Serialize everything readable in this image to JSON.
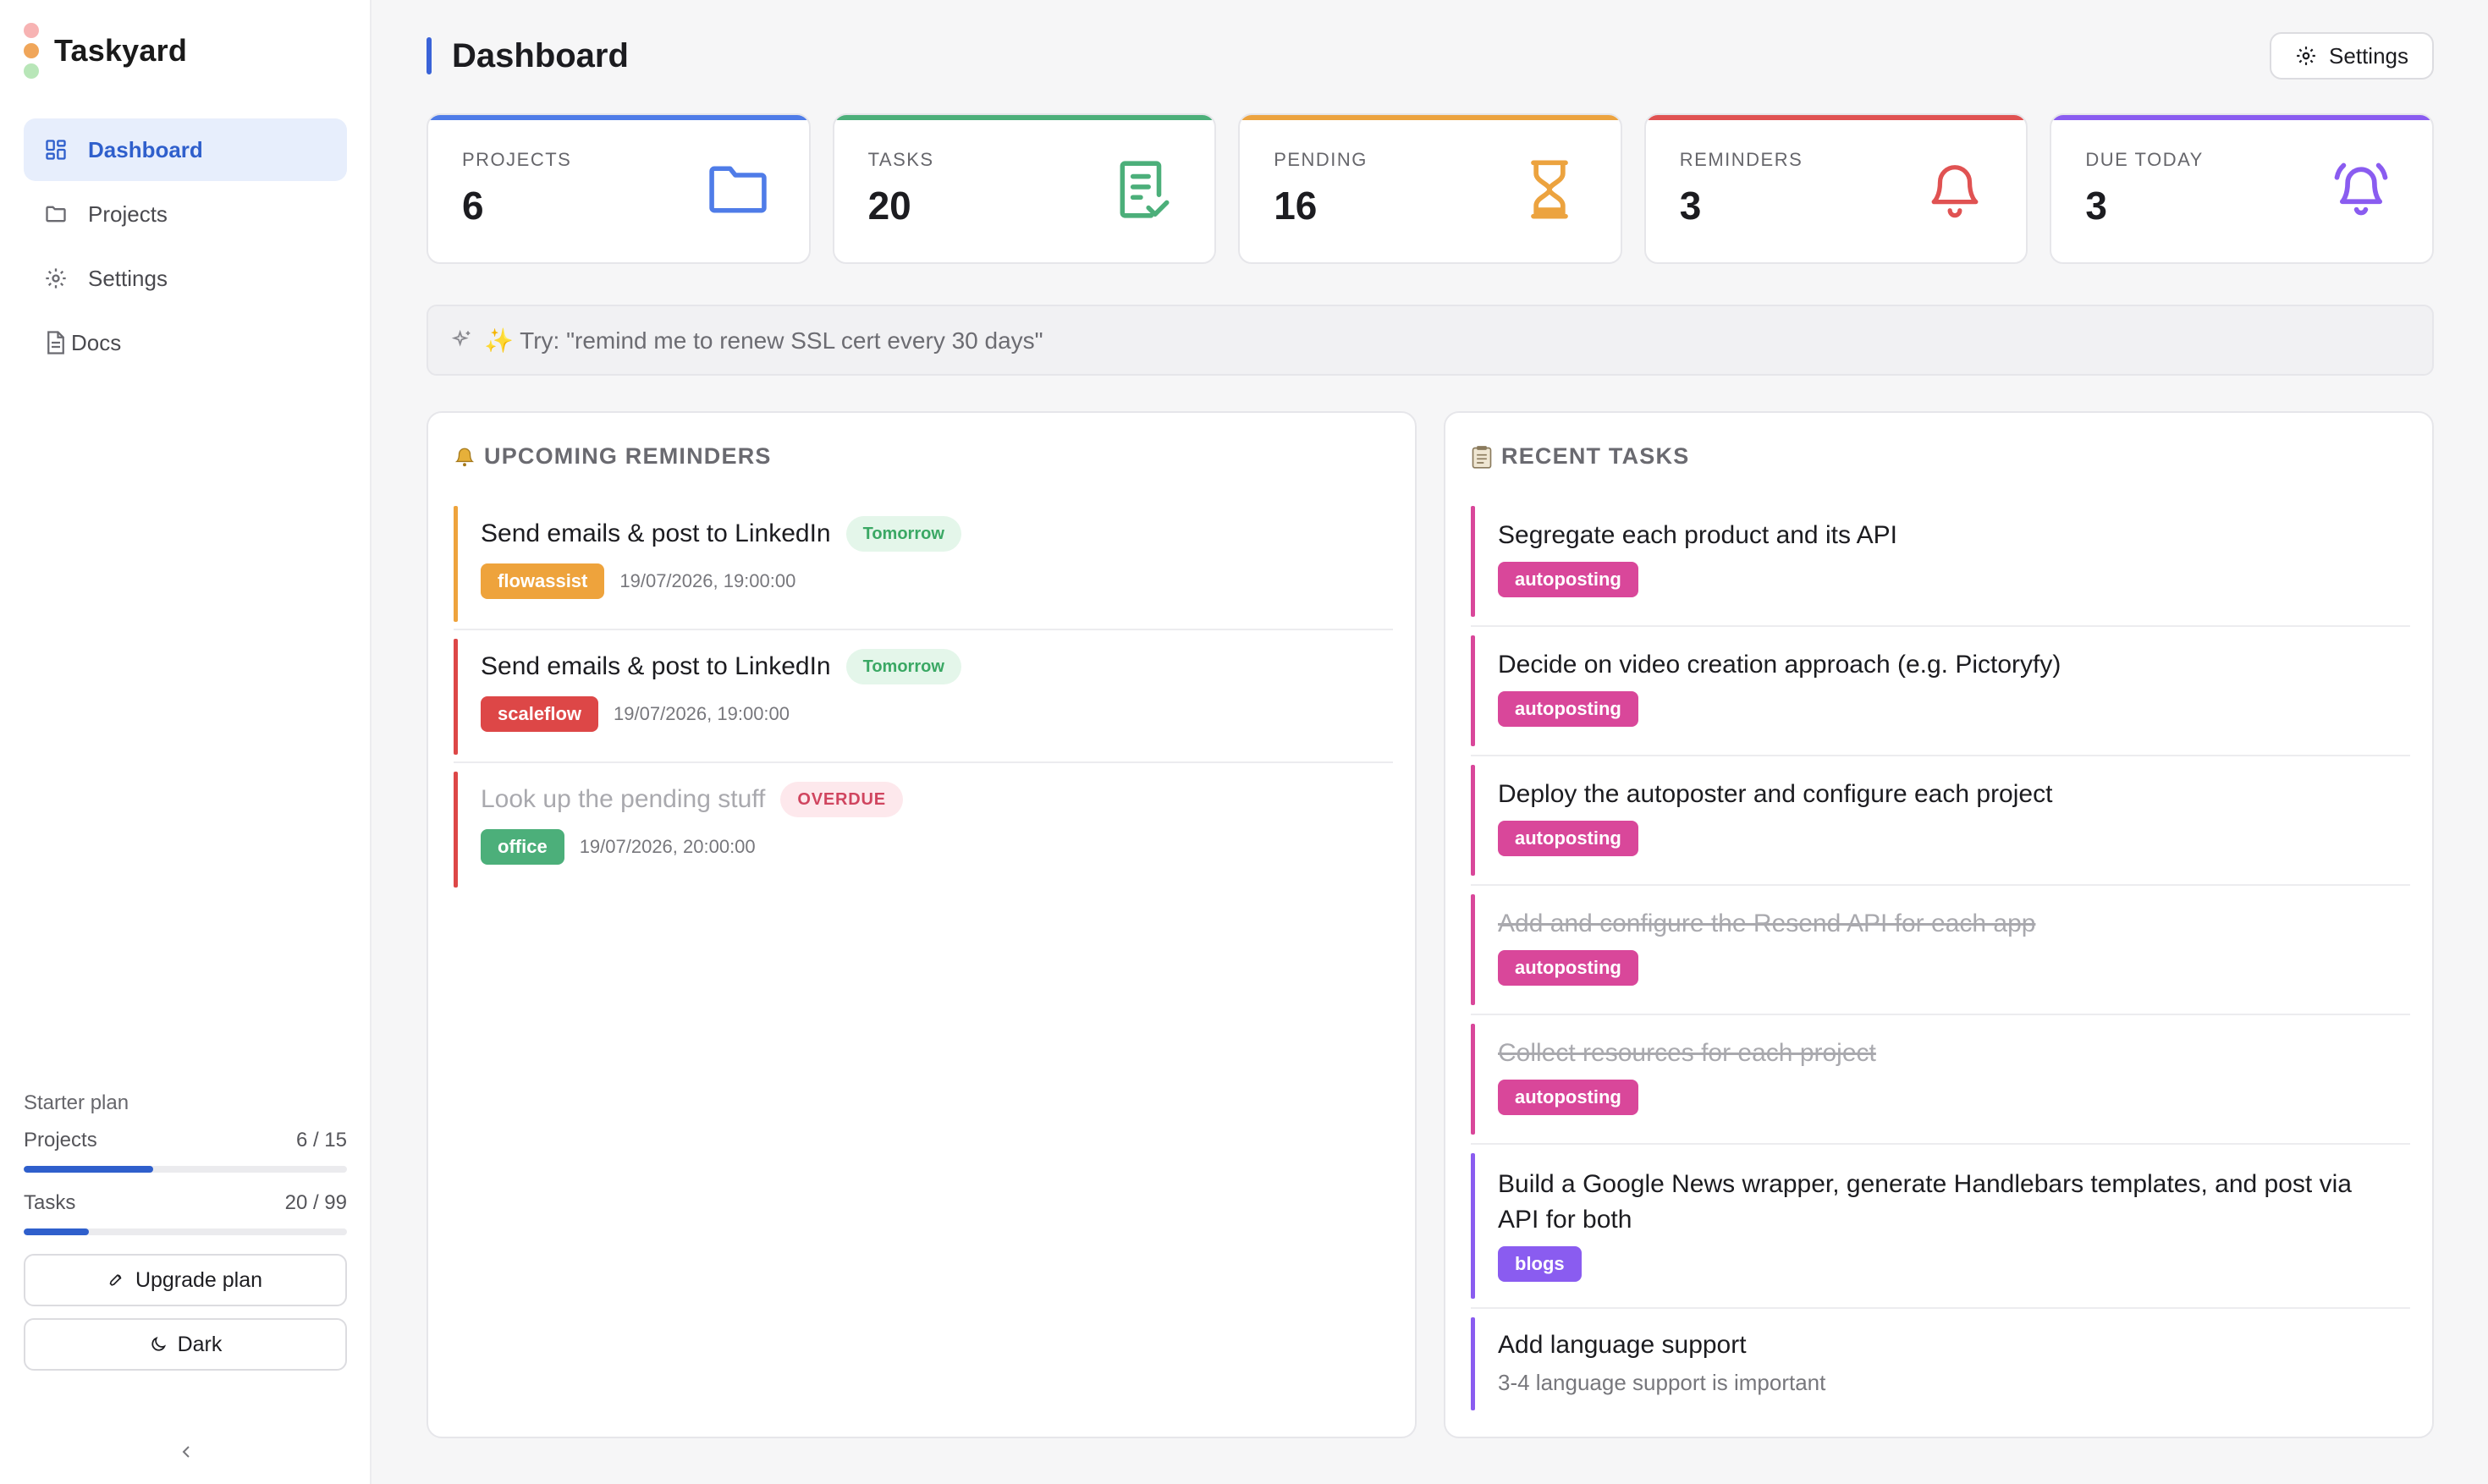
{
  "app": {
    "name": "Taskyard",
    "dot_colors": [
      "#f7b3b3",
      "#f0a65a",
      "#b8e6b8"
    ]
  },
  "sidebar": {
    "items": [
      {
        "label": "Dashboard",
        "icon": "grid-icon",
        "active": true
      },
      {
        "label": "Projects",
        "icon": "folder-icon",
        "active": false
      },
      {
        "label": "Settings",
        "icon": "gear-icon",
        "active": false
      },
      {
        "label": "Docs",
        "icon": "document-icon",
        "active": false
      }
    ],
    "plan": {
      "title": "Starter plan",
      "projects": {
        "label": "Projects",
        "count": "6 / 15",
        "fraction": 0.4
      },
      "tasks": {
        "label": "Tasks",
        "count": "20 / 99",
        "fraction": 0.202
      },
      "upgrade_label": "Upgrade plan",
      "dark_label": "Dark"
    }
  },
  "header": {
    "title": "Dashboard",
    "settings_label": "Settings"
  },
  "stats": [
    {
      "label": "PROJECTS",
      "value": "6",
      "color": "#4f7ce8",
      "icon": "folder-icon"
    },
    {
      "label": "TASKS",
      "value": "20",
      "color": "#4caf7a",
      "icon": "checklist-icon"
    },
    {
      "label": "PENDING",
      "value": "16",
      "color": "#eca33f",
      "icon": "hourglass-icon"
    },
    {
      "label": "REMINDERS",
      "value": "3",
      "color": "#e05252",
      "icon": "bell-icon"
    },
    {
      "label": "DUE TODAY",
      "value": "3",
      "color": "#8a5cf0",
      "icon": "alarm-bell-icon"
    }
  ],
  "prompt": {
    "text": "✨ Try: \"remind me to renew SSL cert every 30 days\""
  },
  "reminders": {
    "header": "UPCOMING REMINDERS",
    "items": [
      {
        "title": "Send emails & post to LinkedIn",
        "badge": "Tomorrow",
        "badge_type": "tomorrow",
        "tag": "flowassist",
        "tag_color": "#eea33c",
        "date": "19/07/2026, 19:00:00",
        "bar_color": "#eea33c"
      },
      {
        "title": "Send emails & post to LinkedIn",
        "badge": "Tomorrow",
        "badge_type": "tomorrow",
        "tag": "scaleflow",
        "tag_color": "#dd4747",
        "date": "19/07/2026, 19:00:00",
        "bar_color": "#dd4747"
      },
      {
        "title": "Look up the pending stuff",
        "badge": "OVERDUE",
        "badge_type": "overdue",
        "tag": "office",
        "tag_color": "#4caf7a",
        "date": "19/07/2026, 20:00:00",
        "bar_color": "#dd4747"
      }
    ]
  },
  "tasks": {
    "header": "RECENT TASKS",
    "items": [
      {
        "title": "Segregate each product and its API",
        "tag": "autoposting",
        "tag_color": "#d9479a",
        "done": false
      },
      {
        "title": "Decide on video creation approach (e.g. Pictoryfy)",
        "tag": "autoposting",
        "tag_color": "#d9479a",
        "done": false
      },
      {
        "title": "Deploy the autoposter and configure each project",
        "tag": "autoposting",
        "tag_color": "#d9479a",
        "done": false
      },
      {
        "title": "Add and configure the Resend API for each app",
        "tag": "autoposting",
        "tag_color": "#d9479a",
        "done": true
      },
      {
        "title": "Collect resources for each project",
        "tag": "autoposting",
        "tag_color": "#d9479a",
        "done": true
      },
      {
        "title": "Build a Google News wrapper, generate Handlebars templates, and post via API for both",
        "tag": "blogs",
        "tag_color": "#8a5cf0",
        "done": false
      },
      {
        "title": "Add language support",
        "desc": "3-4 language support is important",
        "tag": "",
        "bar_color": "#8a5cf0",
        "done": false
      }
    ]
  }
}
